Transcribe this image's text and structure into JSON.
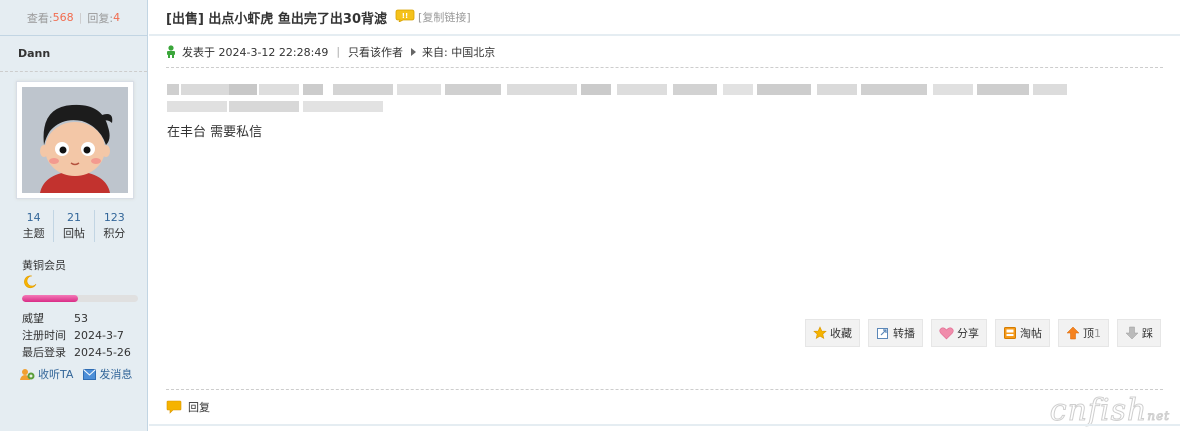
{
  "stats": {
    "views_label": "查看:",
    "views": "568",
    "replies_label": "回复:",
    "replies": "4"
  },
  "author": {
    "name": "Dann"
  },
  "counts": [
    {
      "value": "14",
      "label": "主题"
    },
    {
      "value": "21",
      "label": "回帖"
    },
    {
      "value": "123",
      "label": "积分"
    }
  ],
  "group": {
    "name": "黄铜会员",
    "level_icon": "moon-icon",
    "progress_fraction": 0.48
  },
  "info": [
    {
      "k": "威望",
      "v": "53"
    },
    {
      "k": "注册时间",
      "v": "2024-3-7"
    },
    {
      "k": "最后登录",
      "v": "2024-5-26"
    }
  ],
  "ta_links": {
    "follow": "收听TA",
    "message": "发消息"
  },
  "thread": {
    "title": "[出售] 出点小虾虎 鱼出完了出30背滤",
    "copy_link": "[复制链接]"
  },
  "meta": {
    "posted": "发表于 2024-3-12 22:28:49",
    "only_author": "只看该作者",
    "from": "来自:  中国北京"
  },
  "post": {
    "text": "在丰台 需要私信"
  },
  "actions": [
    {
      "name": "favorite",
      "label": "收藏",
      "icon": "star-icon"
    },
    {
      "name": "forward",
      "label": "转播",
      "icon": "forward-icon"
    },
    {
      "name": "share",
      "label": "分享",
      "icon": "heart-icon"
    },
    {
      "name": "tao",
      "label": "淘帖",
      "icon": "tao-icon"
    },
    {
      "name": "up",
      "label": "顶",
      "count": "1",
      "icon": "arrow-up-icon"
    },
    {
      "name": "down",
      "label": "踩",
      "icon": "arrow-down-icon"
    }
  ],
  "reply": {
    "label": "回复"
  },
  "watermark": {
    "text": "cnfish",
    "suffix": "net"
  },
  "colors": {
    "sidebar_bg": "#e5edf2",
    "accent_red": "#f26c4f",
    "link_blue": "#336699",
    "progress_pink": "#e84a9a"
  }
}
